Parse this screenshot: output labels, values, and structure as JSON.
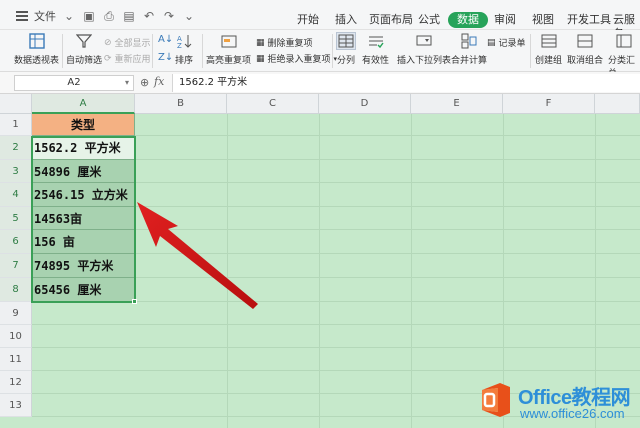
{
  "menubar": {
    "file_label": "文件",
    "tabs": [
      "开始",
      "插入",
      "页面布局",
      "公式",
      "数据",
      "审阅",
      "视图",
      "开发工具",
      "云服务"
    ],
    "active_tab": "数据",
    "accent_color": "#27a35a"
  },
  "ribbon": {
    "pivot": "数据透视表",
    "autofilter": "自动筛选",
    "show_all": "全部显示",
    "reapply": "重新应用",
    "sort": "排序",
    "highlight_dup": "高亮重复项",
    "delete_dup": "删除重复项",
    "reject_dup": "拒绝录入重复项",
    "split": "分列",
    "validity": "有效性",
    "insert_dropdown": "插入下拉列表",
    "consolidate": "合并计算",
    "record": "记录单",
    "create_group": "创建组",
    "ungroup": "取消组合",
    "subtotal": "分类汇总"
  },
  "formula_bar": {
    "name_box": "A2",
    "fx_label": "fx",
    "value": "1562.2 平方米"
  },
  "sheet": {
    "columns": [
      "A",
      "B",
      "C",
      "D",
      "E",
      "F"
    ],
    "rows": [
      "1",
      "2",
      "3",
      "4",
      "5",
      "6",
      "7",
      "8",
      "9",
      "10",
      "11",
      "12",
      "13"
    ],
    "header_cell": "类型",
    "cells": [
      "1562.2 平方米",
      "54896 厘米",
      "2546.15 立方米",
      "14563亩",
      "156 亩",
      "74895 平方米",
      "65456 厘米"
    ],
    "header_fill": "#f4b183",
    "data_fill": "#a8d2b0",
    "grid_fill": "#c6e9cb"
  },
  "watermark": {
    "title": "Office教程网",
    "url": "www.office26.com"
  }
}
